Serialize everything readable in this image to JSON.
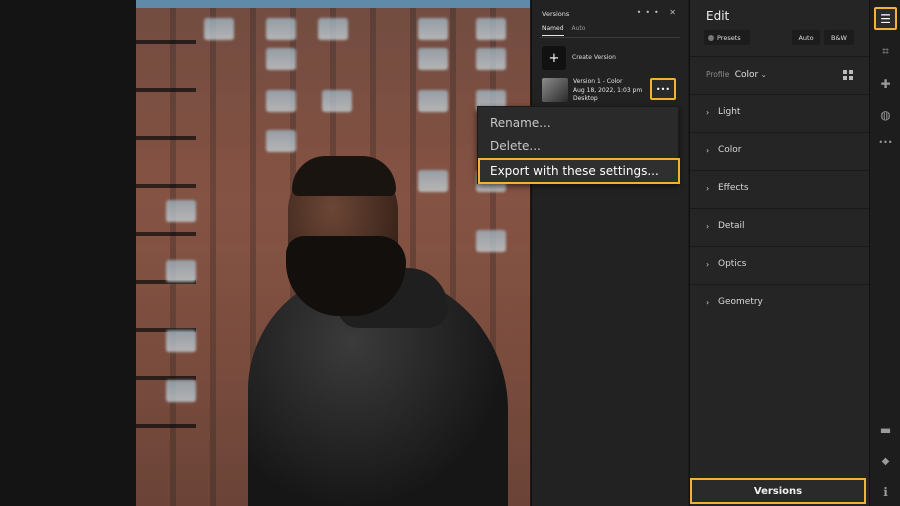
{
  "versions_panel": {
    "title": "Versions",
    "header_icons": "••• ✕",
    "tabs": [
      {
        "label": "Named",
        "active": true
      },
      {
        "label": "Auto",
        "active": false
      }
    ],
    "create_icon": "+",
    "create_label": "Create Version",
    "version": {
      "name": "Version 1 - Color",
      "date": "Aug 18, 2022, 1:03 pm",
      "source": "Desktop",
      "more_icon": "•••"
    }
  },
  "context_menu": {
    "items": [
      "Rename...",
      "Delete...",
      "Export with these settings..."
    ],
    "highlighted_index": 2
  },
  "edit_panel": {
    "title": "Edit",
    "presets_label": "Presets",
    "auto_label": "Auto",
    "bw_label": "B&W",
    "profile_label": "Profile",
    "profile_value": "Color",
    "profile_chevron": "⌄",
    "sections": [
      "Light",
      "Color",
      "Effects",
      "Detail",
      "Optics",
      "Geometry"
    ],
    "chevron": "›"
  },
  "versions_button": "Versions",
  "toolbar": {
    "icons": [
      {
        "name": "edit-sliders-icon",
        "glyph": "☰",
        "active": true
      },
      {
        "name": "crop-icon",
        "glyph": "⌗",
        "active": false
      },
      {
        "name": "healing-bandage-icon",
        "glyph": "✚",
        "active": false
      },
      {
        "name": "masking-icon",
        "glyph": "◍",
        "active": false
      },
      {
        "name": "more-icon",
        "glyph": "•••",
        "active": false
      },
      {
        "name": "comment-icon",
        "glyph": "▬",
        "active": false
      },
      {
        "name": "tag-icon",
        "glyph": "◆",
        "active": false
      },
      {
        "name": "info-icon",
        "glyph": "ℹ",
        "active": false
      }
    ]
  },
  "colors": {
    "highlight": "#f2b233",
    "panel_bg": "#252525"
  }
}
